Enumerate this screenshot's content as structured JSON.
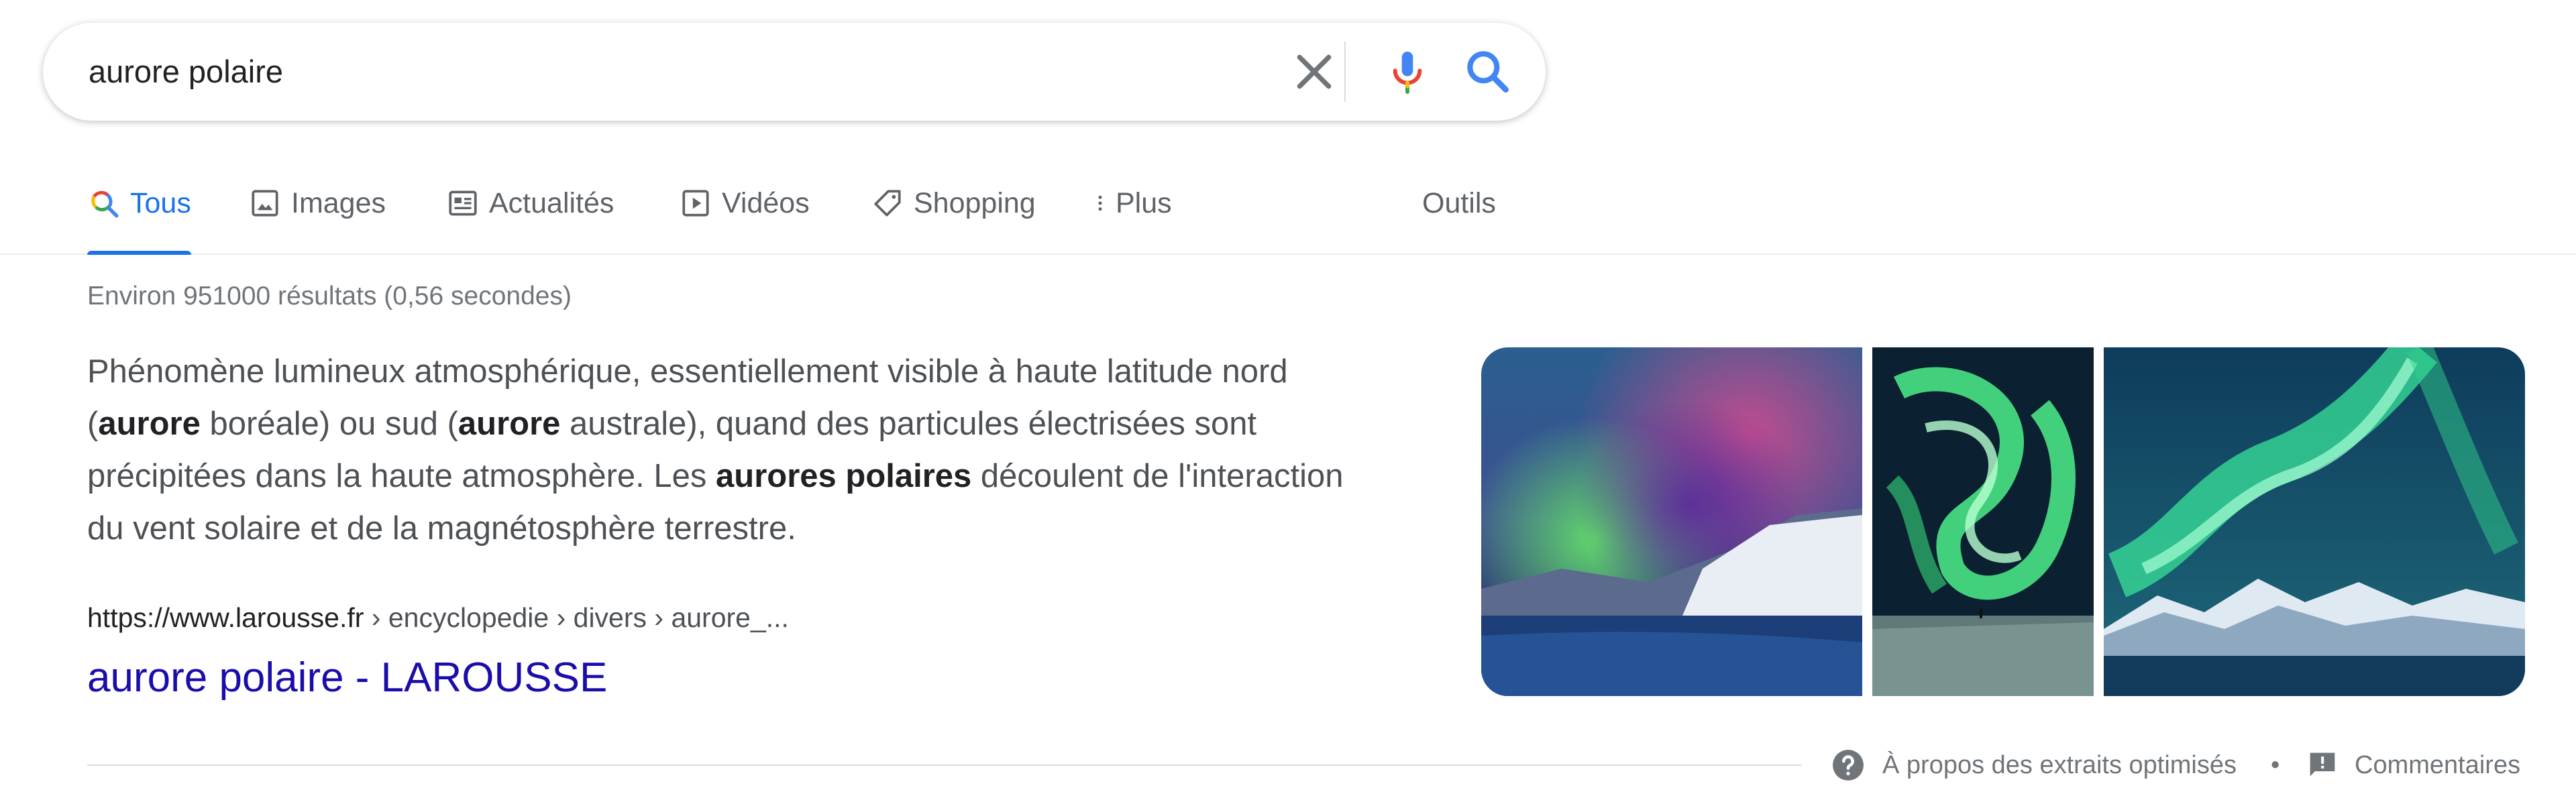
{
  "search": {
    "query": "aurore polaire",
    "icons": [
      "clear-icon",
      "microphone-icon",
      "search-icon"
    ]
  },
  "tabs": [
    {
      "label": "Tous",
      "icon": "search-icon",
      "active": true
    },
    {
      "label": "Images",
      "icon": "image-icon"
    },
    {
      "label": "Actualités",
      "icon": "news-icon"
    },
    {
      "label": "Vidéos",
      "icon": "play-icon"
    },
    {
      "label": "Shopping",
      "icon": "tag-icon"
    },
    {
      "label": "Plus",
      "icon": "more-vert-icon"
    },
    {
      "label": "Outils"
    }
  ],
  "results_stats": "Environ 951000 résultats (0,56 secondes)",
  "featured_snippet": {
    "text_parts": [
      {
        "text": "Phénomène lumineux atmosphérique, essentiellement visible à haute latitude nord (",
        "bold": false
      },
      {
        "text": "aurore",
        "bold": true
      },
      {
        "text": " boréale) ou sud (",
        "bold": false
      },
      {
        "text": "aurore",
        "bold": true
      },
      {
        "text": " australe), quand des particules électrisées sont précipitées dans la haute atmosphère. Les ",
        "bold": false
      },
      {
        "text": "aurores polaires",
        "bold": true
      },
      {
        "text": " découlent de l'interaction du vent solaire et de la magnétosphère terrestre.",
        "bold": false
      }
    ],
    "cite": {
      "domain": "https://www.larousse.fr",
      "path": " › encyclopedie › divers › aurore_..."
    },
    "title": "aurore polaire - LAROUSSE",
    "images": [
      "aurora-image-1",
      "aurora-image-2",
      "aurora-image-3"
    ]
  },
  "footer": {
    "about": "À propos des extraits optimisés",
    "separator": "•",
    "comments": "Commentaires"
  },
  "colors": {
    "link": "#1a0dab",
    "accent": "#1a73e8",
    "text": "#4d5156",
    "muted": "#70757a"
  }
}
